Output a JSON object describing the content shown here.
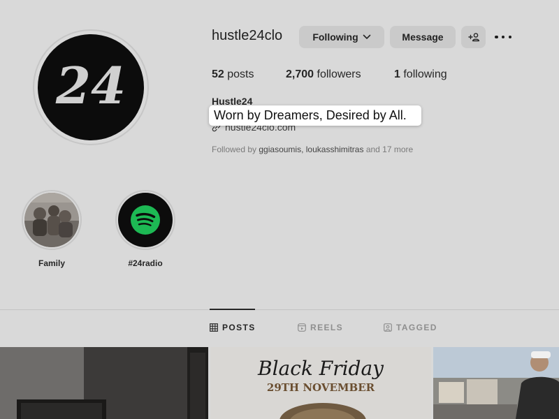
{
  "profile": {
    "username": "hustle24clo",
    "avatar_text": "24",
    "buttons": {
      "following": "Following",
      "message": "Message"
    },
    "stats": {
      "posts_count": "52",
      "posts_label": "posts",
      "followers_count": "2,700",
      "followers_label": "followers",
      "following_count": "1",
      "following_label": "following"
    },
    "bio": {
      "name": "Hustle24",
      "tagline": "Worn by Dreamers, Desired by All.",
      "link": "hustle24clo.com"
    },
    "followed_by": {
      "prefix": "Followed by",
      "user1": "ggiasoumis",
      "separator": ",",
      "user2": "loukasshimitras",
      "suffix": "and 17 more"
    }
  },
  "highlights": [
    {
      "label": "Family",
      "icon": "family-photo"
    },
    {
      "label": "#24radio",
      "icon": "spotify-icon"
    }
  ],
  "tabs": [
    {
      "label": "POSTS",
      "icon": "grid-icon",
      "active": true
    },
    {
      "label": "REELS",
      "icon": "reels-icon",
      "active": false
    },
    {
      "label": "TAGGED",
      "icon": "tagged-icon",
      "active": false
    }
  ],
  "posts": [
    {
      "type": "photo"
    },
    {
      "title": "Black Friday",
      "subtitle": "29TH NOVEMBER"
    },
    {
      "type": "photo"
    }
  ],
  "colors": {
    "background": "#d9d9d9",
    "button": "#cacaca",
    "spotify": "#1db954",
    "avatar_bg": "#0c0c0c"
  }
}
